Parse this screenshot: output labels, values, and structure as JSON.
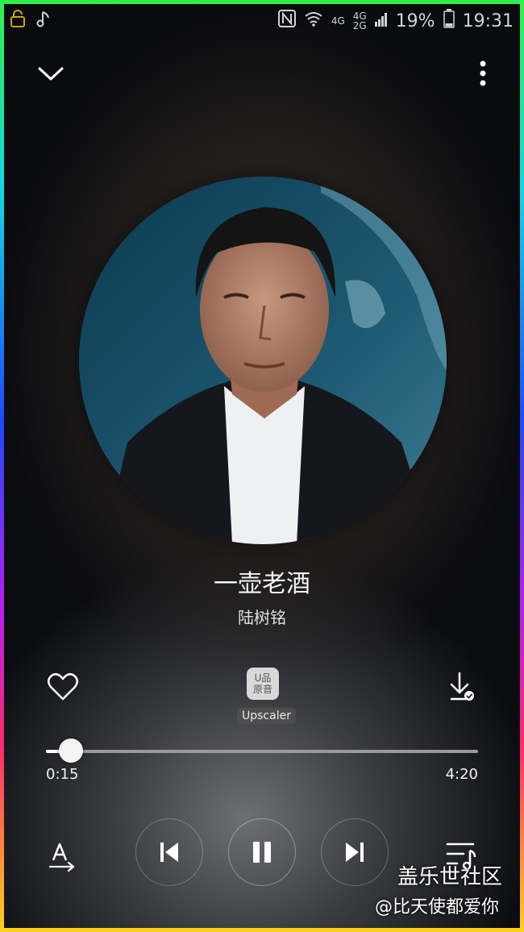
{
  "status_bar": {
    "network_4g": "4G",
    "network_4g_2g": "4G\n2G",
    "battery_percent": "19%",
    "time": "19:31"
  },
  "player": {
    "song_title": "一壶老酒",
    "artist": "陆树铭",
    "upscaler_badge": "U品\n原音",
    "upscaler_label": "Upscaler",
    "elapsed": "0:15",
    "duration": "4:20",
    "progress_fraction": 0.058
  },
  "watermark": {
    "line1": "盖乐世社区",
    "line2": "@比天使都爱你"
  }
}
